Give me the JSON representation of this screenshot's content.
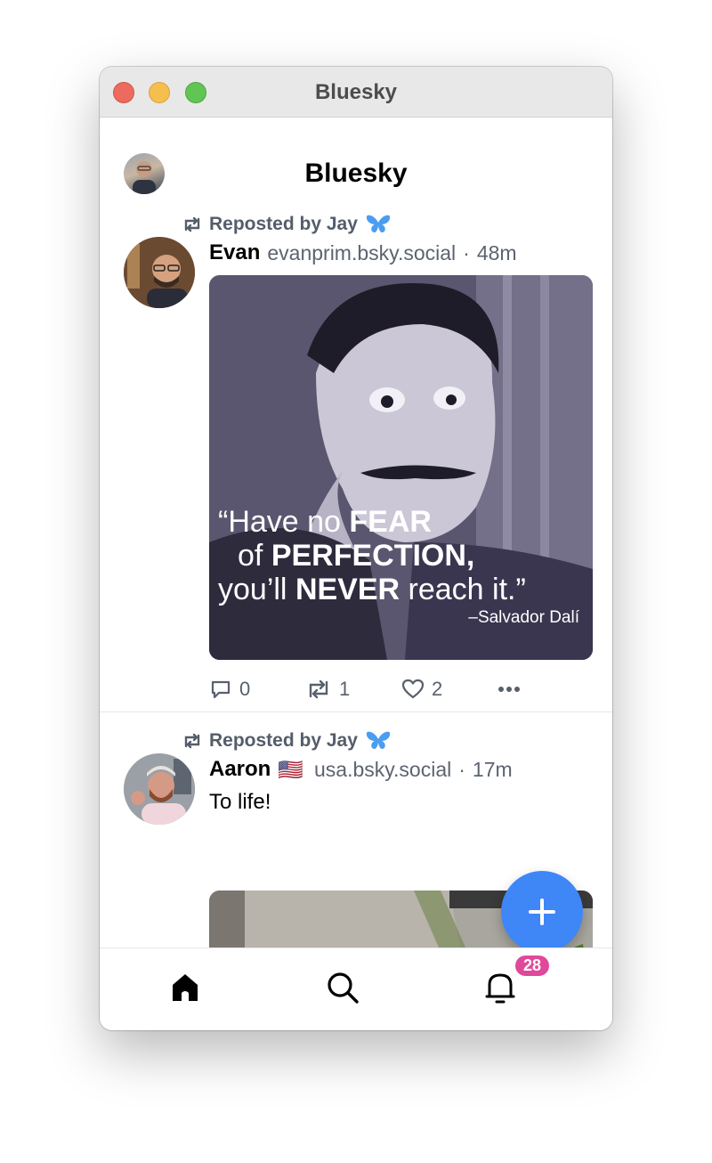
{
  "window": {
    "title": "Bluesky"
  },
  "header": {
    "title": "Bluesky",
    "avatar_icon": "user-avatar"
  },
  "posts": [
    {
      "repost_text": "Reposted by Jay",
      "author_name": "Evan",
      "author_handle": "evanprim.bsky.social",
      "separator": "·",
      "time": "48m",
      "image_quote": {
        "line1_pre": "“Have no ",
        "line1_bold": "FEAR",
        "line2_pre": "of ",
        "line2_bold": "PERFECTION,",
        "line3_pre": "you’ll ",
        "line3_bold": "NEVER",
        "line3_post": " reach it.”",
        "attribution": "–Salvador Dalí"
      },
      "counts": {
        "replies": "0",
        "reposts": "1",
        "likes": "2"
      }
    },
    {
      "repost_text": "Reposted by Jay",
      "author_name": "Aaron",
      "author_flag": "🇺🇸",
      "author_handle": "usa.bsky.social",
      "separator": "·",
      "time": "17m",
      "text": "To life!"
    }
  ],
  "fab": {
    "icon": "plus-icon"
  },
  "tabs": {
    "home_icon": "home-icon",
    "search_icon": "search-icon",
    "notifications_icon": "bell-icon",
    "notifications_badge": "28"
  },
  "colors": {
    "accent": "#3f86f7",
    "badge": "#e0499a",
    "muted": "#5c6470"
  }
}
